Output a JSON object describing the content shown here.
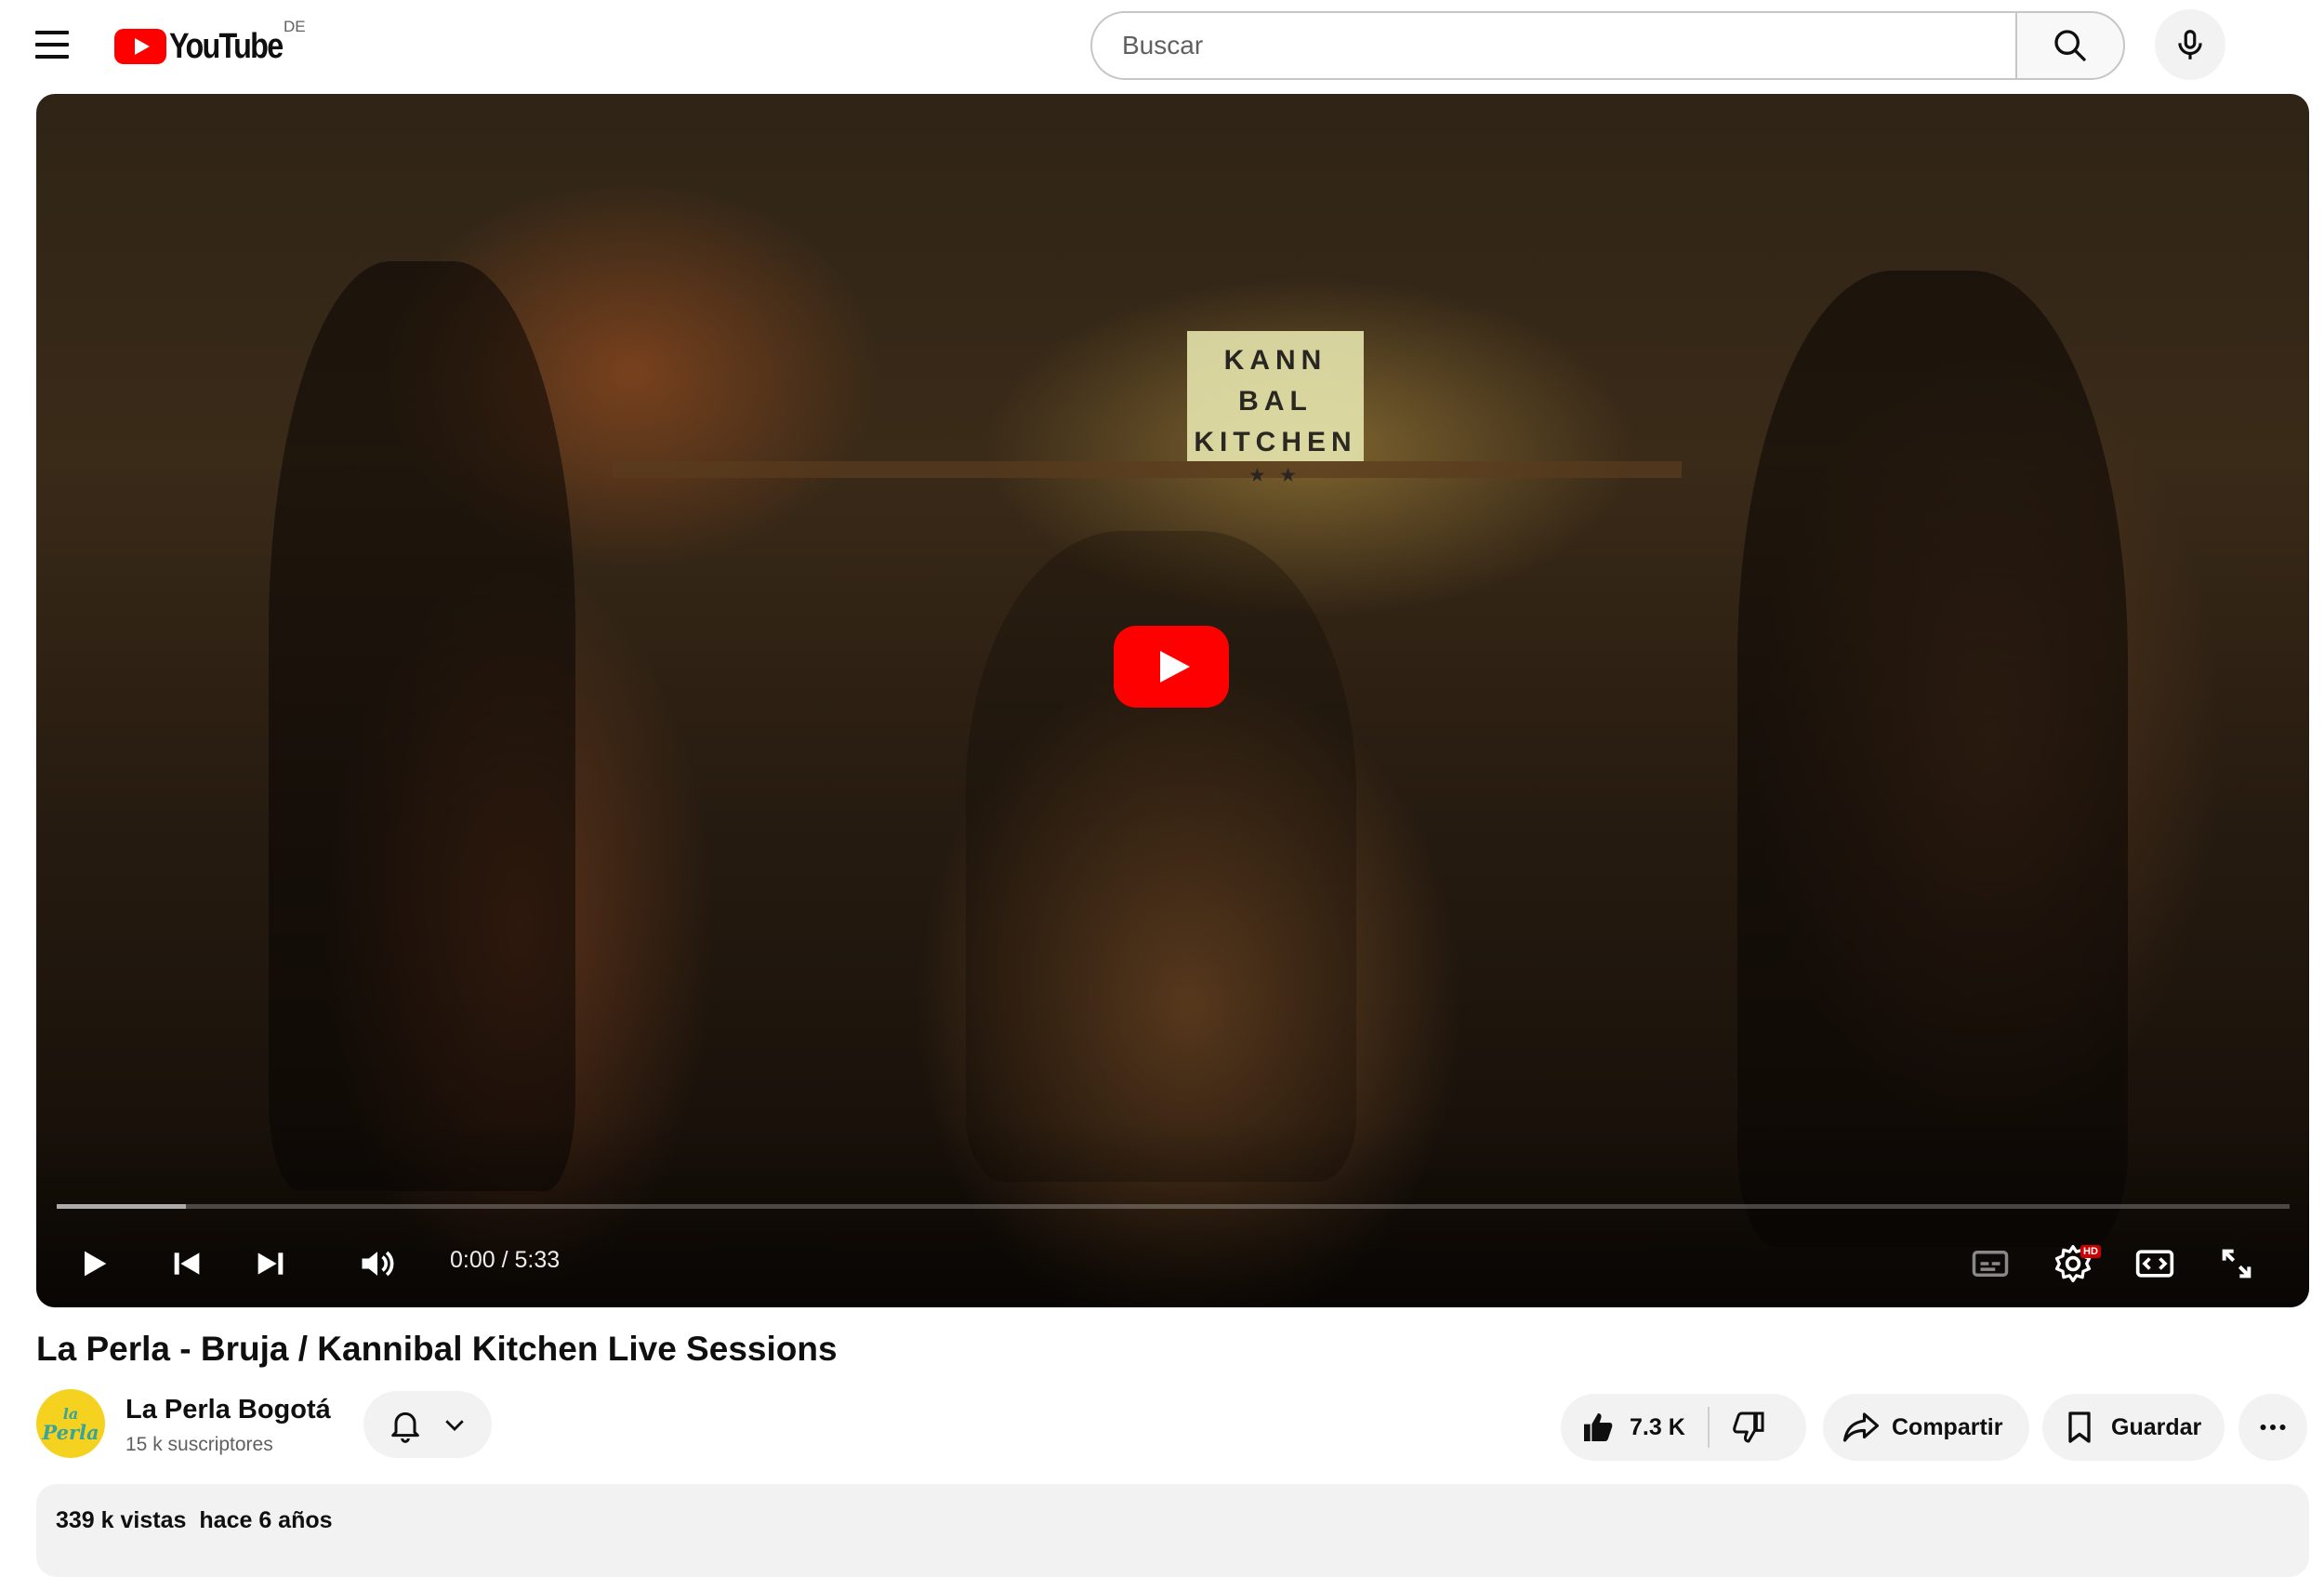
{
  "header": {
    "logo_text": "YouTube",
    "country_code": "DE",
    "search_placeholder": "Buscar",
    "search_value": ""
  },
  "player": {
    "scene_sign": [
      "KANN BAL",
      "KITCHEN",
      "★ ★"
    ],
    "current_time": "0:00",
    "time_separator": "/",
    "duration": "5:33",
    "buffered_fraction": 0.058,
    "played_fraction": 0.0,
    "hd_badge": "HD"
  },
  "video": {
    "title": "La Perla - Bruja / Kannibal Kitchen Live Sessions",
    "channel_name": "La Perla Bogotá",
    "subscribers": "15 k suscriptores",
    "avatar_text": [
      "la",
      "Perla"
    ],
    "likes": "7.3 K",
    "share_label": "Compartir",
    "save_label": "Guardar",
    "views": "339 k vistas",
    "published": "hace 6 años"
  },
  "colors": {
    "brand_red": "#ff0000",
    "avatar_yellow": "#f4d21f",
    "pill_bg": "#f2f2f2",
    "text_secondary": "#606060"
  },
  "icons": [
    "menu-icon",
    "search-icon",
    "mic-icon",
    "play-icon",
    "previous-icon",
    "next-icon",
    "volume-icon",
    "subtitles-icon",
    "settings-icon",
    "theater-icon",
    "fullscreen-icon",
    "bell-icon",
    "chevron-down-icon",
    "like-icon",
    "dislike-icon",
    "share-icon",
    "bookmark-icon",
    "more-icon"
  ]
}
